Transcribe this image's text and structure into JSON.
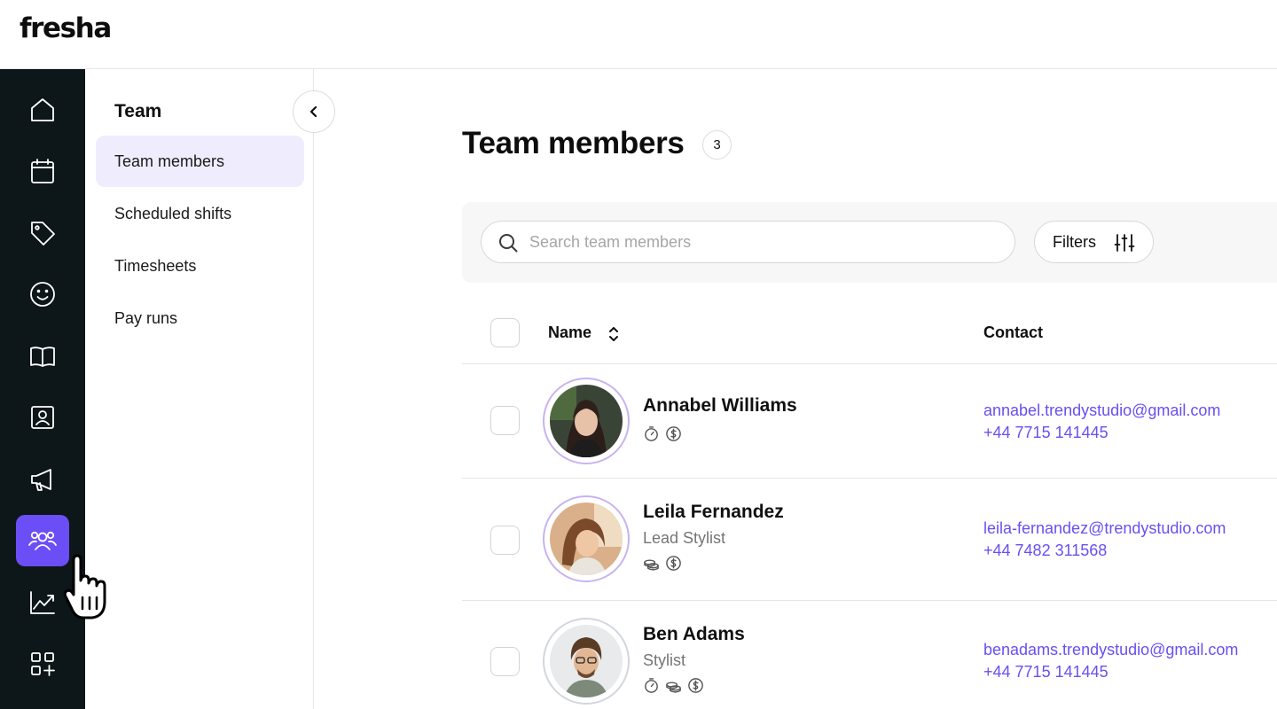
{
  "brand": {
    "logo": "fresha"
  },
  "rail": {
    "items": [
      {
        "icon": "home-icon",
        "active": false
      },
      {
        "icon": "calendar-icon",
        "active": false
      },
      {
        "icon": "tag-icon",
        "active": false
      },
      {
        "icon": "smiley-icon",
        "active": false
      },
      {
        "icon": "book-icon",
        "active": false
      },
      {
        "icon": "contact-card-icon",
        "active": false
      },
      {
        "icon": "megaphone-icon",
        "active": false
      },
      {
        "icon": "team-icon",
        "active": true
      },
      {
        "icon": "chart-icon",
        "active": false
      },
      {
        "icon": "apps-add-icon",
        "active": false
      }
    ],
    "active_color": "#6c4ef6"
  },
  "subnav": {
    "title": "Team",
    "items": [
      {
        "label": "Team members",
        "active": true
      },
      {
        "label": "Scheduled shifts",
        "active": false
      },
      {
        "label": "Timesheets",
        "active": false
      },
      {
        "label": "Pay runs",
        "active": false
      }
    ]
  },
  "main": {
    "title": "Team members",
    "count": "3",
    "search": {
      "placeholder": "Search team members",
      "value": ""
    },
    "filters_label": "Filters",
    "columns": {
      "name": "Name",
      "contact": "Contact"
    },
    "members": [
      {
        "name": "Annabel Williams",
        "role": "",
        "icons": [
          "timer-icon",
          "dollar-icon"
        ],
        "email": "annabel.trendystudio@gmail.com",
        "phone": "+44 7715 141445"
      },
      {
        "name": "Leila Fernandez",
        "role": "Lead Stylist",
        "icons": [
          "coins-icon",
          "dollar-icon"
        ],
        "email": "leila-fernandez@trendystudio.com",
        "phone": "+44 7482 311568"
      },
      {
        "name": "Ben Adams",
        "role": "Stylist",
        "icons": [
          "timer-icon",
          "coins-icon",
          "dollar-icon"
        ],
        "email": "benadams.trendystudio@gmail.com",
        "phone": "+44 7715 141445"
      }
    ],
    "link_color": "#6a4ff0"
  }
}
